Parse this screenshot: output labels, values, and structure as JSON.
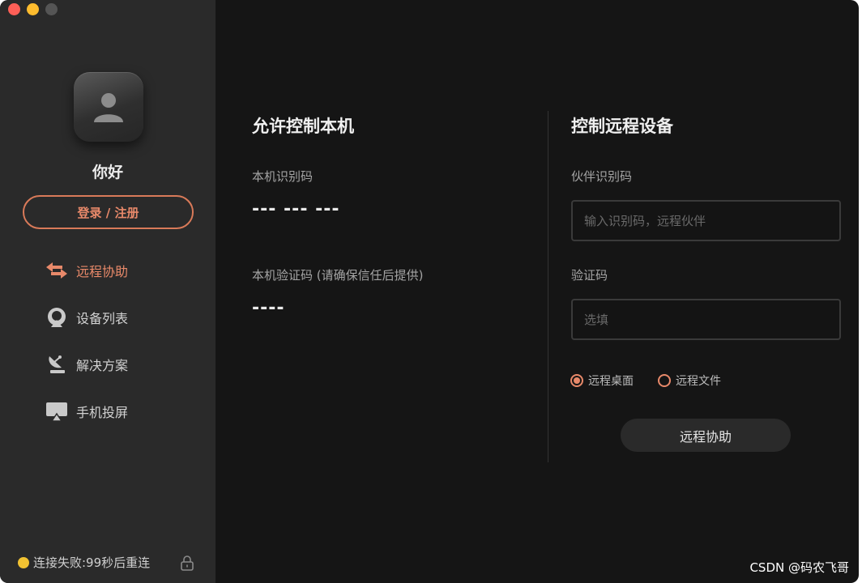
{
  "sidebar": {
    "greeting": "你好",
    "login_label": "登录 / 注册",
    "nav": [
      {
        "label": "远程协助",
        "icon": "swap-arrows-icon",
        "active": true
      },
      {
        "label": "设备列表",
        "icon": "device-list-icon",
        "active": false
      },
      {
        "label": "解决方案",
        "icon": "satellite-dish-icon",
        "active": false
      },
      {
        "label": "手机投屏",
        "icon": "screen-cast-icon",
        "active": false
      }
    ],
    "status_text": "连接失败:99秒后重连"
  },
  "allow_control": {
    "title": "允许控制本机",
    "id_label": "本机识别码",
    "id_value": "--- --- ---",
    "code_label": "本机验证码 (请确保信任后提供)",
    "code_value": "----"
  },
  "remote_control": {
    "title": "控制远程设备",
    "partner_label": "伙伴识别码",
    "partner_placeholder": "输入识别码，远程伙伴",
    "verify_label": "验证码",
    "verify_placeholder": "选填",
    "modes": [
      {
        "label": "远程桌面",
        "selected": true
      },
      {
        "label": "远程文件",
        "selected": false
      }
    ],
    "submit_label": "远程协助"
  },
  "watermark": "CSDN @码农飞哥",
  "colors": {
    "accent": "#e8896a",
    "status_dot": "#f1c232",
    "background": "#151515",
    "sidebar": "#2a2a2a"
  }
}
